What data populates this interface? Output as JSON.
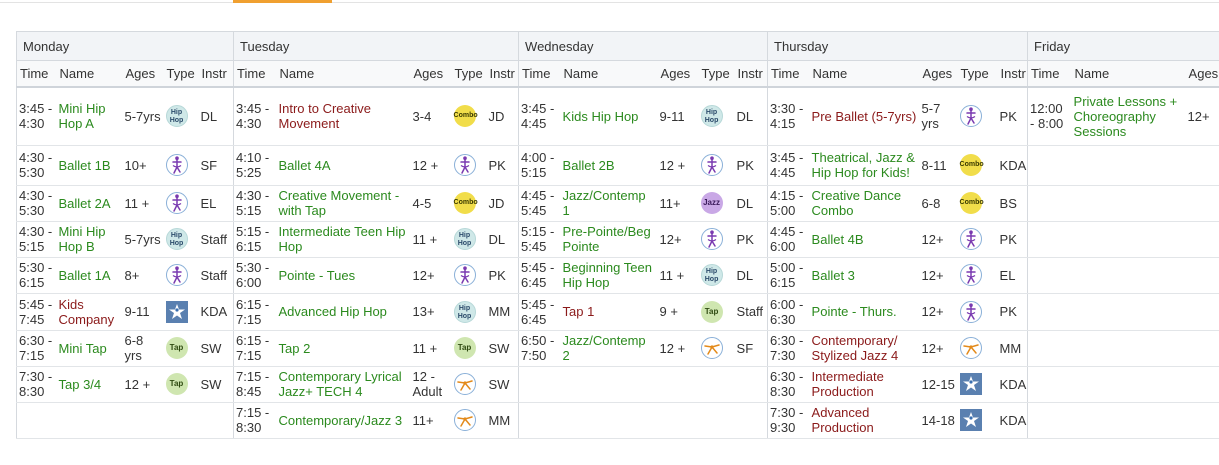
{
  "days": [
    "Monday",
    "Tuesday",
    "Wednesday",
    "Thursday",
    "Friday"
  ],
  "columns": {
    "time": "Time",
    "name": "Name",
    "ages": "Ages",
    "type": "Type",
    "instr": "Instr"
  },
  "icon_labels": {
    "hiphop_1": "Hip",
    "hiphop_2": "Hop",
    "combo": "Combo",
    "tap": "Tap",
    "jazz": "Jazz"
  },
  "colors": {
    "green": "#2b8a1e",
    "red": "#8b1a1a",
    "accent": "#f0a030"
  },
  "rows": [
    [
      {
        "time": "3:45 - 4:30",
        "name": "Mini Hip Hop A",
        "color": "green",
        "ages": "5-7yrs",
        "type": "hiphop",
        "instr": "DL"
      },
      {
        "time": "3:45 - 4:30",
        "name": "Intro to Creative Movement",
        "color": "red",
        "ages": "3-4",
        "type": "combo",
        "instr": "JD"
      },
      {
        "time": "3:45 - 4:45",
        "name": "Kids Hip Hop",
        "color": "green",
        "ages": "9-11",
        "type": "hiphop",
        "instr": "DL"
      },
      {
        "time": "3:30 - 4:15",
        "name": "Pre Ballet (5-7yrs)",
        "color": "red",
        "ages": "5-7 yrs",
        "type": "ballet",
        "instr": "PK"
      },
      {
        "time": "12:00 - 8:00",
        "name": "Private Lessons + Choreography Sessions",
        "color": "green",
        "ages": "12+",
        "type": "",
        "instr": ""
      }
    ],
    [
      {
        "time": "4:30 - 5:30",
        "name": "Ballet 1B",
        "color": "green",
        "ages": "10+",
        "type": "ballet",
        "instr": "SF"
      },
      {
        "time": "4:10 - 5:25",
        "name": "Ballet 4A",
        "color": "green",
        "ages": "12 +",
        "type": "ballet",
        "instr": "PK"
      },
      {
        "time": "4:00 - 5:15",
        "name": "Ballet 2B",
        "color": "green",
        "ages": "12 +",
        "type": "ballet",
        "instr": "PK"
      },
      {
        "time": "3:45 - 4:45",
        "name": "Theatrical, Jazz & Hip Hop for Kids!",
        "color": "green",
        "ages": "8-11",
        "type": "combo",
        "instr": "KDA"
      },
      null
    ],
    [
      {
        "time": "4:30 - 5:30",
        "name": "Ballet 2A",
        "color": "green",
        "ages": "11 +",
        "type": "ballet",
        "instr": "EL"
      },
      {
        "time": "4:30 - 5:15",
        "name": "Creative Movement - with Tap",
        "color": "green",
        "ages": "4-5",
        "type": "combo",
        "instr": "JD"
      },
      {
        "time": "4:45 - 5:45",
        "name": "Jazz/Contemp 1",
        "color": "green",
        "ages": "11+",
        "type": "jazz",
        "instr": "DL"
      },
      {
        "time": "4:15 - 5:00",
        "name": "Creative Dance Combo",
        "color": "green",
        "ages": "6-8",
        "type": "combo",
        "instr": "BS"
      },
      null
    ],
    [
      {
        "time": "4:30 - 5:15",
        "name": "Mini Hip Hop B",
        "color": "green",
        "ages": "5-7yrs",
        "type": "hiphop",
        "instr": "Staff"
      },
      {
        "time": "5:15 - 6:15",
        "name": "Intermediate Teen Hip Hop",
        "color": "green",
        "ages": "11 +",
        "type": "hiphop",
        "instr": "DL"
      },
      {
        "time": "5:15 - 5:45",
        "name": "Pre-Pointe/Beg Pointe",
        "color": "green",
        "ages": "12+",
        "type": "ballet",
        "instr": "PK"
      },
      {
        "time": "4:45 - 6:00",
        "name": "Ballet 4B",
        "color": "green",
        "ages": "12+",
        "type": "ballet",
        "instr": "PK"
      },
      null
    ],
    [
      {
        "time": "5:30 - 6:15",
        "name": "Ballet 1A",
        "color": "green",
        "ages": "8+",
        "type": "ballet",
        "instr": "Staff"
      },
      {
        "time": "5:30 - 6:00",
        "name": "Pointe - Tues",
        "color": "green",
        "ages": "12+",
        "type": "ballet",
        "instr": "PK"
      },
      {
        "time": "5:45 - 6:45",
        "name": "Beginning Teen Hip Hop",
        "color": "green",
        "ages": "11 +",
        "type": "hiphop",
        "instr": "DL"
      },
      {
        "time": "5:00 - 6:15",
        "name": "Ballet 3",
        "color": "green",
        "ages": "12+",
        "type": "ballet",
        "instr": "EL"
      },
      null
    ],
    [
      {
        "time": "5:45 - 7:45",
        "name": "Kids Company",
        "color": "red",
        "ages": "9-11",
        "type": "prod",
        "instr": "KDA"
      },
      {
        "time": "6:15 - 7:15",
        "name": "Advanced Hip Hop",
        "color": "green",
        "ages": "13+",
        "type": "hiphop",
        "instr": "MM"
      },
      {
        "time": "5:45 - 6:45",
        "name": "Tap 1",
        "color": "red",
        "ages": "9 +",
        "type": "tap",
        "instr": "Staff"
      },
      {
        "time": "6:00 - 6:30",
        "name": "Pointe - Thurs.",
        "color": "green",
        "ages": "12+",
        "type": "ballet",
        "instr": "PK"
      },
      null
    ],
    [
      {
        "time": "6:30 - 7:15",
        "name": "Mini Tap",
        "color": "green",
        "ages": "6-8 yrs",
        "type": "tap",
        "instr": "SW"
      },
      {
        "time": "6:15 - 7:15",
        "name": "Tap 2",
        "color": "green",
        "ages": "11 +",
        "type": "tap",
        "instr": "SW"
      },
      {
        "time": "6:50 - 7:50",
        "name": "Jazz/Contemp 2",
        "color": "green",
        "ages": "12 +",
        "type": "contemp",
        "instr": "SF"
      },
      {
        "time": "6:30 - 7:30",
        "name": "Contemporary/ Stylized Jazz 4",
        "color": "red",
        "ages": "12+",
        "type": "contemp",
        "instr": "MM"
      },
      null
    ],
    [
      {
        "time": "7:30 - 8:30",
        "name": "Tap 3/4",
        "color": "green",
        "ages": "12 +",
        "type": "tap",
        "instr": "SW"
      },
      {
        "time": "7:15 - 8:45",
        "name": "Contemporary Lyrical Jazz+ TECH 4",
        "color": "green",
        "ages": "12 - Adult",
        "type": "contemp",
        "instr": "SW"
      },
      null,
      {
        "time": "6:30 - 8:30",
        "name": "Intermediate Production",
        "color": "red",
        "ages": "12-15",
        "type": "prod",
        "instr": "KDA"
      },
      null
    ],
    [
      null,
      {
        "time": "7:15 - 8:30",
        "name": "Contemporary/Jazz 3",
        "color": "green",
        "ages": "11+",
        "type": "contemp",
        "instr": "MM"
      },
      null,
      {
        "time": "7:30 - 9:30",
        "name": "Advanced Production",
        "color": "red",
        "ages": "14-18",
        "type": "prod",
        "instr": "KDA"
      },
      null
    ]
  ]
}
